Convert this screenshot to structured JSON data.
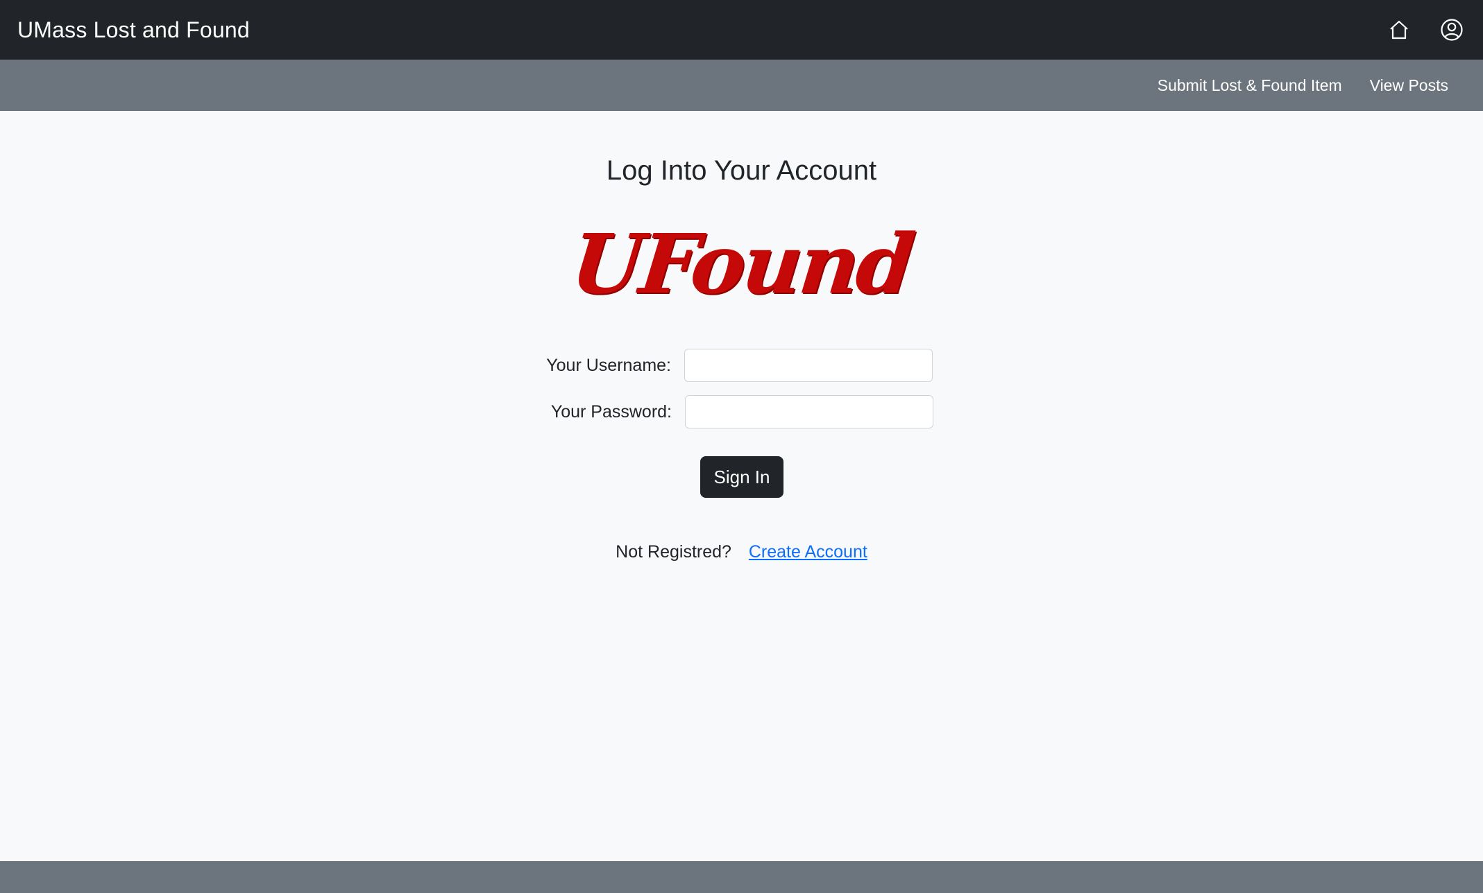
{
  "navbar": {
    "brand": "UMass Lost and Found",
    "icons": [
      "home-icon",
      "user-account-icon"
    ]
  },
  "subnav": {
    "items": [
      {
        "label": "Submit Lost & Found Item"
      },
      {
        "label": "View Posts"
      }
    ]
  },
  "login": {
    "title": "Log Into Your Account",
    "logo_text": "UFound",
    "username_label": "Your Username:",
    "username_value": "",
    "password_label": "Your Password:",
    "password_value": "",
    "sign_in_label": "Sign In",
    "register_prompt": "Not Registred?",
    "create_account_label": "Create Account"
  },
  "colors": {
    "navbar_bg": "#212529",
    "subnav_bg": "#6c757d",
    "page_bg": "#f8f9fa",
    "logo_red": "#c50808",
    "link_blue": "#0d6efd"
  }
}
